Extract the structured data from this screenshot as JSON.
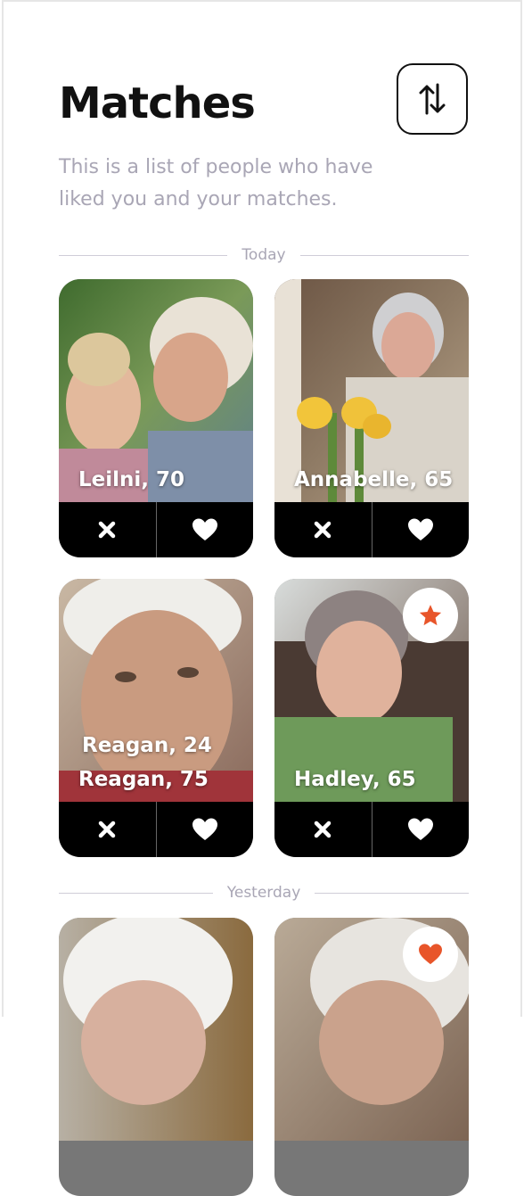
{
  "header": {
    "title": "Matches",
    "sort_icon": "sort-arrows-icon"
  },
  "subtitle": "This is a list of people who have liked you and your matches.",
  "sections": [
    {
      "label": "Today"
    },
    {
      "label": "Yesterday"
    }
  ],
  "cards": [
    {
      "name": "Leilni, 70"
    },
    {
      "name": "Annabelle, 65"
    },
    {
      "name": "Reagan, 75",
      "overlap_name": "Reagan, 24"
    },
    {
      "name": "Hadley, 65",
      "badge": "star-icon"
    },
    {
      "name": "",
      "badge": ""
    },
    {
      "name": "",
      "badge": "heart-icon"
    }
  ],
  "colors": {
    "accent": "#e8552a",
    "text": "#111111",
    "muted": "#a9a6b5"
  }
}
